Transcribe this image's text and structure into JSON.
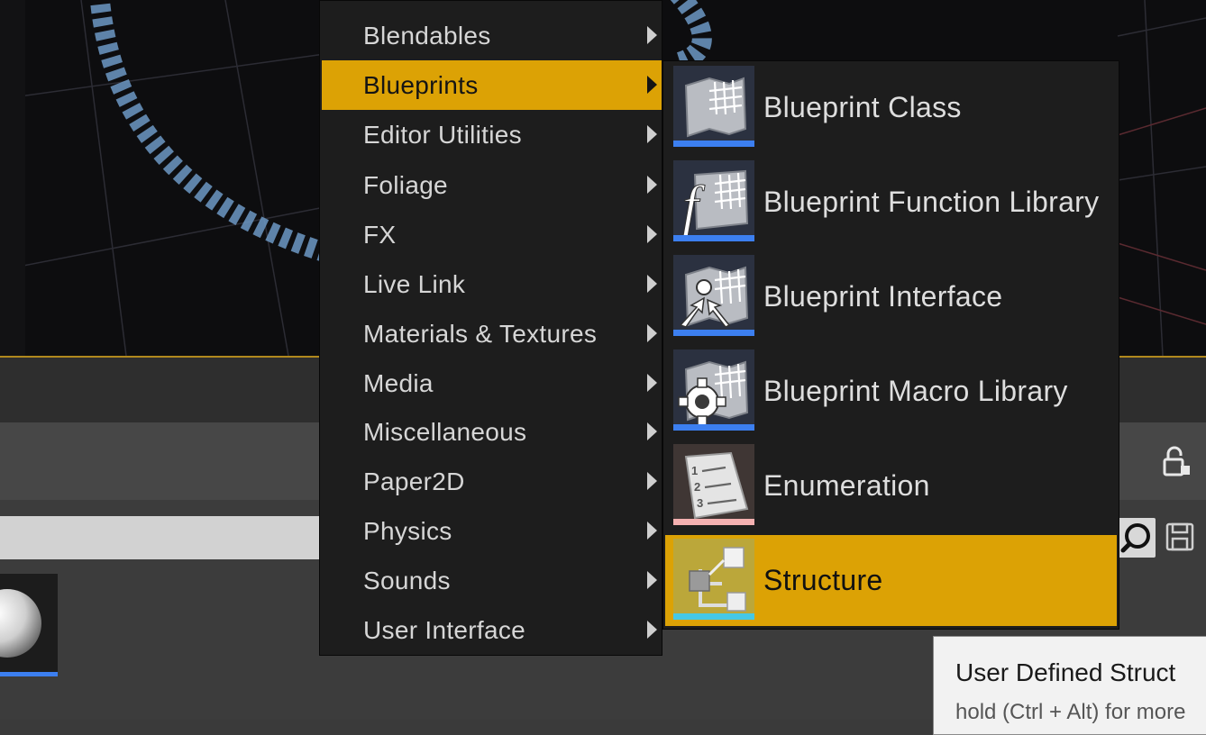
{
  "category_menu": {
    "items": [
      {
        "label": "Blendables",
        "active": false
      },
      {
        "label": "Blueprints",
        "active": true
      },
      {
        "label": "Editor Utilities",
        "active": false
      },
      {
        "label": "Foliage",
        "active": false
      },
      {
        "label": "FX",
        "active": false
      },
      {
        "label": "Live Link",
        "active": false
      },
      {
        "label": "Materials & Textures",
        "active": false
      },
      {
        "label": "Media",
        "active": false
      },
      {
        "label": "Miscellaneous",
        "active": false
      },
      {
        "label": "Paper2D",
        "active": false
      },
      {
        "label": "Physics",
        "active": false
      },
      {
        "label": "Sounds",
        "active": false
      },
      {
        "label": "User Interface",
        "active": false
      }
    ]
  },
  "blueprints_submenu": {
    "items": [
      {
        "label": "Blueprint Class",
        "icon": "blueprint-class-icon",
        "strip_color": "#3c7ff0",
        "active": false
      },
      {
        "label": "Blueprint Function Library",
        "icon": "blueprint-function-library-icon",
        "strip_color": "#3c7ff0",
        "active": false
      },
      {
        "label": "Blueprint Interface",
        "icon": "blueprint-interface-icon",
        "strip_color": "#3c7ff0",
        "active": false
      },
      {
        "label": "Blueprint Macro Library",
        "icon": "blueprint-macro-library-icon",
        "strip_color": "#3c7ff0",
        "active": false
      },
      {
        "label": "Enumeration",
        "icon": "enumeration-icon",
        "strip_color": "#f4b0b0",
        "active": false
      },
      {
        "label": "Structure",
        "icon": "structure-icon",
        "strip_color": "#46c8e6",
        "active": true
      }
    ]
  },
  "tooltip": {
    "title": "User Defined Struct",
    "hint": "hold (Ctrl + Alt) for more"
  },
  "colors": {
    "highlight": "#dca205",
    "menu_bg": "#1d1d1d",
    "viewport_line": "#5e8ab4"
  }
}
